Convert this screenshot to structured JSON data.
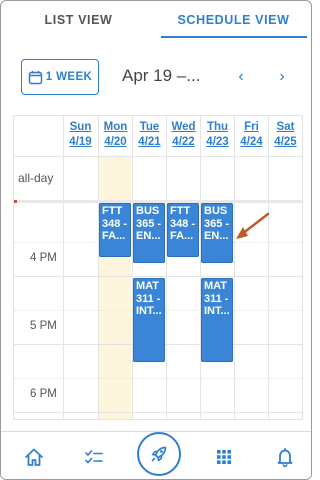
{
  "tabs": [
    {
      "label": "LIST VIEW",
      "active": false
    },
    {
      "label": "SCHEDULE VIEW",
      "active": true
    }
  ],
  "toolbar": {
    "week_label": "1 WEEK",
    "week_icon": "calendar-icon",
    "range_title": "Apr 19 –...",
    "prev": "‹",
    "next": "›"
  },
  "calendar": {
    "days": [
      {
        "name": "Sun",
        "date": "4/19"
      },
      {
        "name": "Mon",
        "date": "4/20"
      },
      {
        "name": "Tue",
        "date": "4/21"
      },
      {
        "name": "Wed",
        "date": "4/22"
      },
      {
        "name": "Thu",
        "date": "4/23"
      },
      {
        "name": "Fri",
        "date": "4/24"
      },
      {
        "name": "Sat",
        "date": "4/25"
      }
    ],
    "allday_label": "all-day",
    "times": [
      "4 PM",
      "5 PM",
      "6 PM"
    ],
    "events": [
      {
        "lines": [
          "FTT",
          "348 -",
          "FA..."
        ]
      },
      {
        "lines": [
          "BUS",
          "365 -",
          "EN..."
        ]
      },
      {
        "lines": [
          "FTT",
          "348 -",
          "FA..."
        ]
      },
      {
        "lines": [
          "BUS",
          "365 -",
          "EN..."
        ]
      },
      {
        "lines": [
          "MAT",
          "311 -",
          "INT..."
        ]
      },
      {
        "lines": [
          "MAT",
          "311 -",
          "INT..."
        ]
      }
    ]
  },
  "colors": {
    "accent": "#2f7fd0",
    "event": "#3a85d6",
    "today": "#fdf6dc",
    "annotation_arrow": "#c0582a"
  },
  "bottom_nav": {
    "items": [
      "home-icon",
      "checklist-icon",
      "rocket-icon",
      "grid-icon",
      "bell-icon"
    ]
  }
}
